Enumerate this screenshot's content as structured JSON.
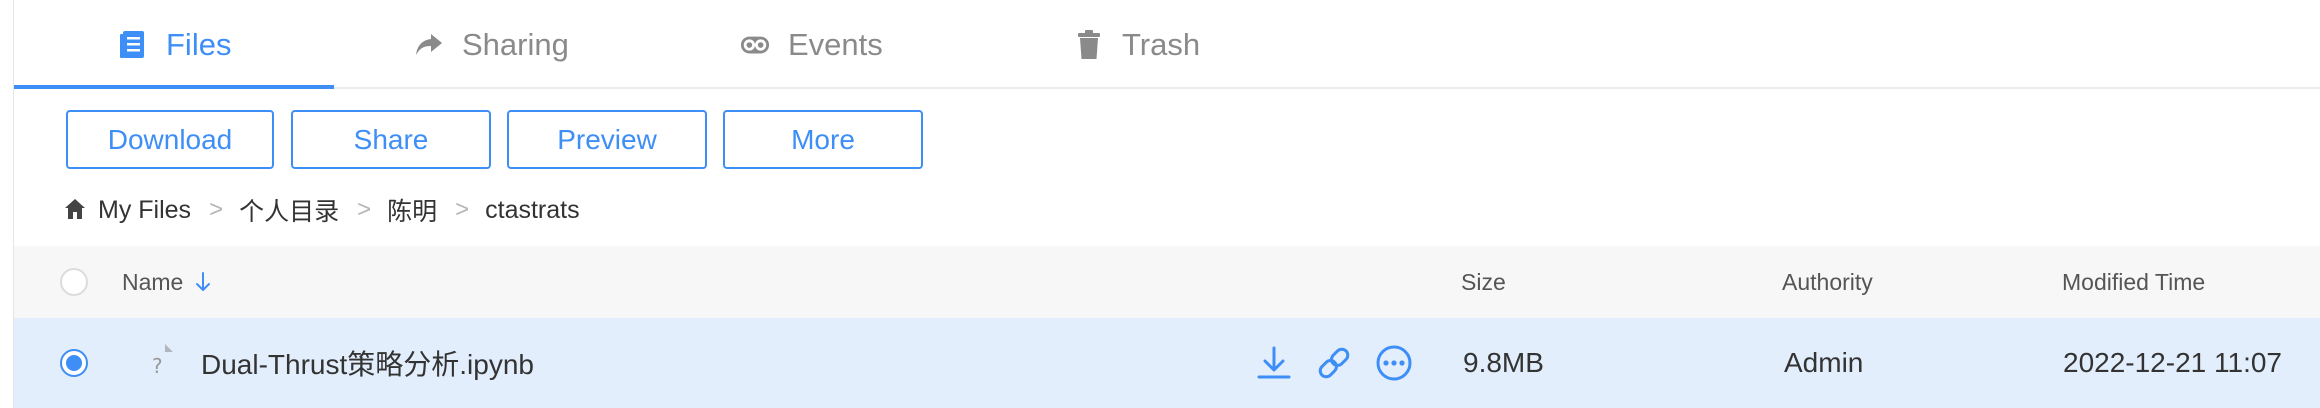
{
  "tabs": [
    {
      "label": "Files",
      "icon": "file-list-icon",
      "active": true
    },
    {
      "label": "Sharing",
      "icon": "share-arrow-icon",
      "active": false
    },
    {
      "label": "Events",
      "icon": "events-icon",
      "active": false
    },
    {
      "label": "Trash",
      "icon": "trash-icon",
      "active": false
    }
  ],
  "toolbar": {
    "download_label": "Download",
    "share_label": "Share",
    "preview_label": "Preview",
    "more_label": "More"
  },
  "breadcrumb": {
    "home_icon": "home-icon",
    "items": [
      "My Files",
      "个人目录",
      "陈明",
      "ctastrats"
    ],
    "separator": ">"
  },
  "table": {
    "columns": {
      "name": "Name",
      "size": "Size",
      "authority": "Authority",
      "modified": "Modified Time"
    },
    "rows": [
      {
        "selected": true,
        "file_icon": "unknown-file-icon",
        "file_icon_glyph": "?",
        "name": "Dual-Thrust策略分析.ipynb",
        "size": "9.8MB",
        "authority": "Admin",
        "modified": "2022-12-21 11:07",
        "actions": [
          "download-icon",
          "link-icon",
          "more-dots-icon"
        ]
      }
    ]
  },
  "colors": {
    "accent": "#3e8ef7",
    "selected_row_bg": "#e3eefc",
    "header_bg": "#f7f7f7",
    "inactive_text": "#8a8a8a"
  }
}
